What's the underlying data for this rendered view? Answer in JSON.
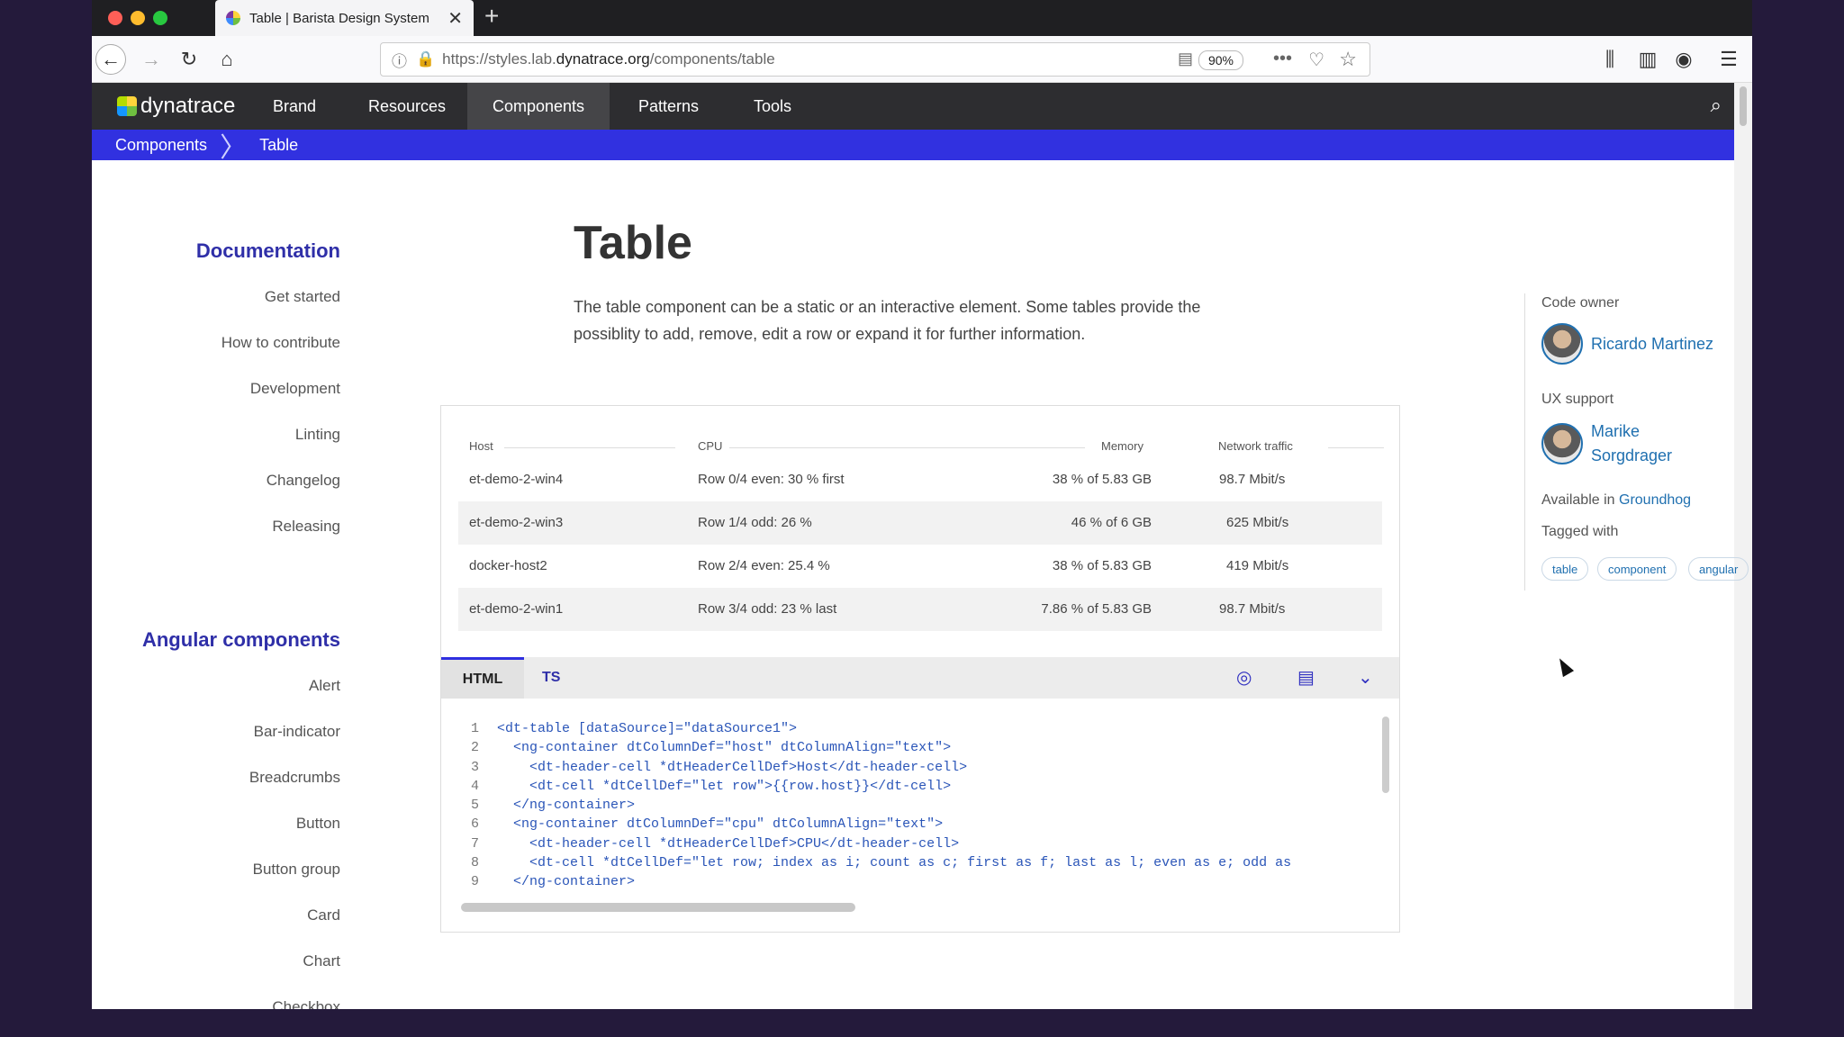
{
  "browser": {
    "tab_title": "Table | Barista Design System",
    "new_tab": "+",
    "url_prefix": "https://styles.lab.",
    "url_host": "dynatrace.org",
    "url_path": "/components/table",
    "zoom": "90%"
  },
  "site": {
    "logo": "dynatrace",
    "nav": [
      "Brand",
      "Resources",
      "Components",
      "Patterns",
      "Tools"
    ],
    "active_nav": "Components"
  },
  "breadcrumb": {
    "parent": "Components",
    "current": "Table"
  },
  "sidebar": {
    "doc_heading": "Documentation",
    "doc_items": [
      "Get started",
      "How to contribute",
      "Development",
      "Linting",
      "Changelog",
      "Releasing"
    ],
    "comp_heading": "Angular components",
    "comp_items": [
      "Alert",
      "Bar-indicator",
      "Breadcrumbs",
      "Button",
      "Button group",
      "Card",
      "Chart",
      "Checkbox"
    ]
  },
  "page": {
    "title": "Table",
    "intro": "The table component can be a static or an interactive element. Some tables provide the possiblity to add, remove, edit a row or expand it for further information."
  },
  "table": {
    "headers": [
      "Host",
      "CPU",
      "Memory",
      "Network traffic"
    ],
    "rows": [
      [
        "et-demo-2-win4",
        "Row 0/4 even: 30 % first",
        "38 % of 5.83 GB",
        "98.7 Mbit/s"
      ],
      [
        "et-demo-2-win3",
        "Row 1/4 odd: 26 %",
        "46 % of 6 GB",
        "625 Mbit/s"
      ],
      [
        "docker-host2",
        "Row 2/4 even: 25.4 %",
        "38 % of 5.83 GB",
        "419 Mbit/s"
      ],
      [
        "et-demo-2-win1",
        "Row 3/4 odd: 23 % last",
        "7.86 % of 5.83 GB",
        "98.7 Mbit/s"
      ]
    ]
  },
  "code": {
    "tabs": [
      "HTML",
      "TS"
    ],
    "lines": [
      "<dt-table [dataSource]=\"dataSource1\">",
      "  <ng-container dtColumnDef=\"host\" dtColumnAlign=\"text\">",
      "    <dt-header-cell *dtHeaderCellDef>Host</dt-header-cell>",
      "    <dt-cell *dtCellDef=\"let row\">{{row.host}}</dt-cell>",
      "  </ng-container>",
      "  <ng-container dtColumnDef=\"cpu\" dtColumnAlign=\"text\">",
      "    <dt-header-cell *dtHeaderCellDef>CPU</dt-header-cell>",
      "    <dt-cell *dtCellDef=\"let row; index as i; count as c; first as f; last as l; even as e; odd as",
      "  </ng-container>"
    ]
  },
  "meta": {
    "code_owner_label": "Code owner",
    "code_owner": "Ricardo Martinez",
    "ux_label": "UX support",
    "ux_name_1": "Marike",
    "ux_name_2": "Sorgdrager",
    "available_label": "Available in",
    "available_link": "Groundhog",
    "tagged_label": "Tagged with",
    "tags": [
      "table",
      "component",
      "angular"
    ]
  },
  "colors": {
    "brand_blue": "#3131e0",
    "header_dark": "#2d2d30",
    "link": "#2070b0"
  }
}
